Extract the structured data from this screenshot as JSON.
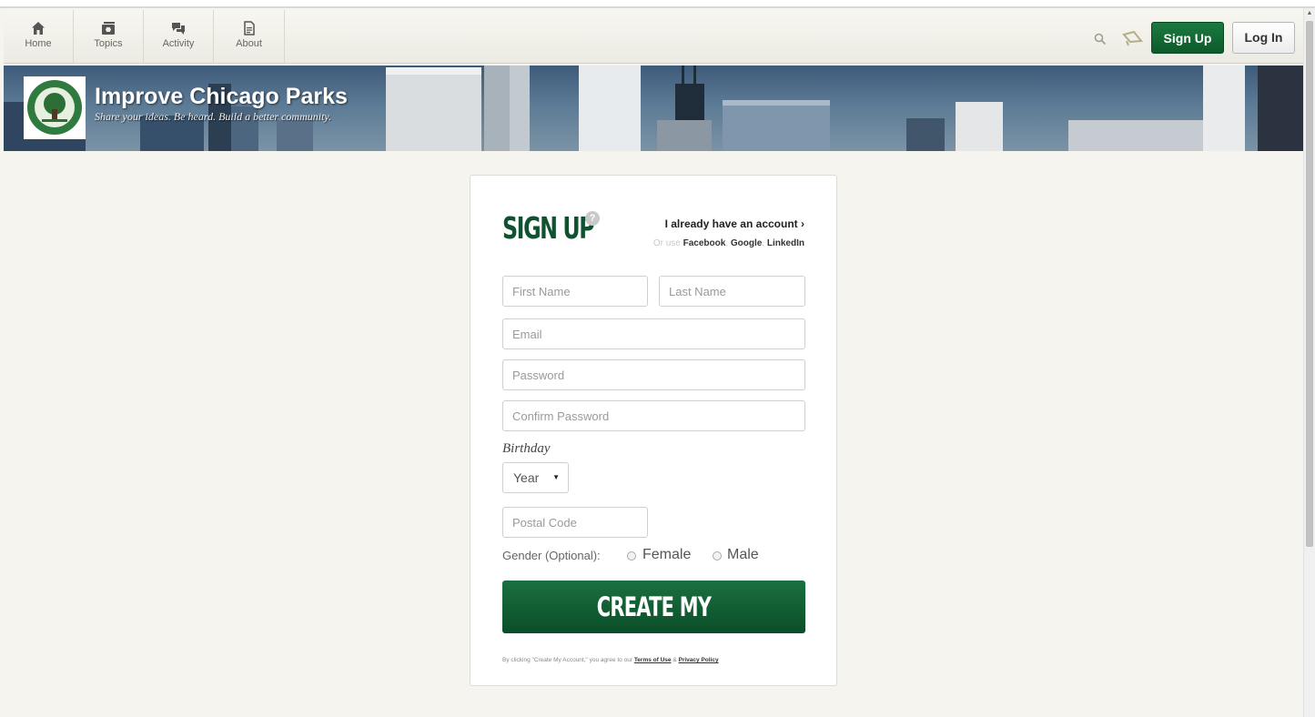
{
  "nav": {
    "items": [
      {
        "label": "Home",
        "icon": "home-icon"
      },
      {
        "label": "Topics",
        "icon": "topics-icon"
      },
      {
        "label": "Activity",
        "icon": "activity-icon"
      },
      {
        "label": "About",
        "icon": "about-icon"
      }
    ],
    "signup_label": "Sign Up",
    "login_label": "Log In"
  },
  "banner": {
    "title": "Improve Chicago Parks",
    "tagline": "Share your ideas. Be heard. Build a better community."
  },
  "form": {
    "title": "SIGN UP",
    "help_icon": "?",
    "have_account": "I already have an account ›",
    "or_use": "Or use",
    "facebook": "Facebook",
    "google": "Google",
    "linkedin": "LinkedIn",
    "first_name_placeholder": "First Name",
    "last_name_placeholder": "Last Name",
    "email_placeholder": "Email",
    "password_placeholder": "Password",
    "confirm_password_placeholder": "Confirm Password",
    "birthday_label": "Birthday",
    "year_value": "Year",
    "postal_placeholder": "Postal Code",
    "gender_label": "Gender (Optional):",
    "female_label": "Female",
    "male_label": "Male",
    "create_button": "CREATE MY ACCOUNT",
    "fine_print_prefix": "By clicking \"Create My Account,\" you agree to our",
    "terms_link": "Terms of Use",
    "amp": "&",
    "privacy_link": "Privacy Policy"
  },
  "colors": {
    "brand_green": "#0e5230",
    "button_green": "#1a7040",
    "page_bg": "#f5f4ef"
  }
}
